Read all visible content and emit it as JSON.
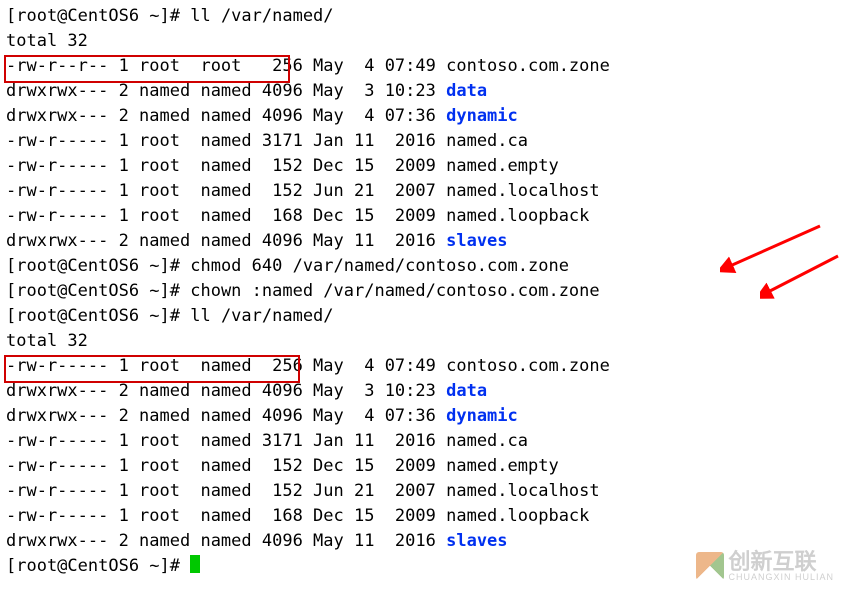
{
  "prompt": "[root@CentOS6 ~]# ",
  "cmd1": "ll /var/named/",
  "total1": "total 32",
  "ls1": [
    {
      "perm": "-rw-r--r--",
      "n": "1",
      "owner": "root ",
      "group": "root ",
      "size": " 256",
      "mo": "May",
      "d": " 4",
      "ty": "07:49",
      "name": "contoso.com.zone",
      "is_dir": false
    },
    {
      "perm": "drwxrwx---",
      "n": "2",
      "owner": "named",
      "group": "named",
      "size": "4096",
      "mo": "May",
      "d": " 3",
      "ty": "10:23",
      "name": "data",
      "is_dir": true
    },
    {
      "perm": "drwxrwx---",
      "n": "2",
      "owner": "named",
      "group": "named",
      "size": "4096",
      "mo": "May",
      "d": " 4",
      "ty": "07:36",
      "name": "dynamic",
      "is_dir": true
    },
    {
      "perm": "-rw-r-----",
      "n": "1",
      "owner": "root ",
      "group": "named",
      "size": "3171",
      "mo": "Jan",
      "d": "11",
      "ty": " 2016",
      "name": "named.ca",
      "is_dir": false
    },
    {
      "perm": "-rw-r-----",
      "n": "1",
      "owner": "root ",
      "group": "named",
      "size": " 152",
      "mo": "Dec",
      "d": "15",
      "ty": " 2009",
      "name": "named.empty",
      "is_dir": false
    },
    {
      "perm": "-rw-r-----",
      "n": "1",
      "owner": "root ",
      "group": "named",
      "size": " 152",
      "mo": "Jun",
      "d": "21",
      "ty": " 2007",
      "name": "named.localhost",
      "is_dir": false
    },
    {
      "perm": "-rw-r-----",
      "n": "1",
      "owner": "root ",
      "group": "named",
      "size": " 168",
      "mo": "Dec",
      "d": "15",
      "ty": " 2009",
      "name": "named.loopback",
      "is_dir": false
    },
    {
      "perm": "drwxrwx---",
      "n": "2",
      "owner": "named",
      "group": "named",
      "size": "4096",
      "mo": "May",
      "d": "11",
      "ty": " 2016",
      "name": "slaves",
      "is_dir": true
    }
  ],
  "cmd2": "chmod 640 /var/named/contoso.com.zone",
  "cmd3": "chown :named /var/named/contoso.com.zone",
  "cmd4": "ll /var/named/",
  "total2": "total 32",
  "ls2": [
    {
      "perm": "-rw-r-----",
      "n": "1",
      "owner": "root ",
      "group": "named",
      "size": " 256",
      "mo": "May",
      "d": " 4",
      "ty": "07:49",
      "name": "contoso.com.zone",
      "is_dir": false
    },
    {
      "perm": "drwxrwx---",
      "n": "2",
      "owner": "named",
      "group": "named",
      "size": "4096",
      "mo": "May",
      "d": " 3",
      "ty": "10:23",
      "name": "data",
      "is_dir": true
    },
    {
      "perm": "drwxrwx---",
      "n": "2",
      "owner": "named",
      "group": "named",
      "size": "4096",
      "mo": "May",
      "d": " 4",
      "ty": "07:36",
      "name": "dynamic",
      "is_dir": true
    },
    {
      "perm": "-rw-r-----",
      "n": "1",
      "owner": "root ",
      "group": "named",
      "size": "3171",
      "mo": "Jan",
      "d": "11",
      "ty": " 2016",
      "name": "named.ca",
      "is_dir": false
    },
    {
      "perm": "-rw-r-----",
      "n": "1",
      "owner": "root ",
      "group": "named",
      "size": " 152",
      "mo": "Dec",
      "d": "15",
      "ty": " 2009",
      "name": "named.empty",
      "is_dir": false
    },
    {
      "perm": "-rw-r-----",
      "n": "1",
      "owner": "root ",
      "group": "named",
      "size": " 152",
      "mo": "Jun",
      "d": "21",
      "ty": " 2007",
      "name": "named.localhost",
      "is_dir": false
    },
    {
      "perm": "-rw-r-----",
      "n": "1",
      "owner": "root ",
      "group": "named",
      "size": " 168",
      "mo": "Dec",
      "d": "15",
      "ty": " 2009",
      "name": "named.loopback",
      "is_dir": false
    },
    {
      "perm": "drwxrwx---",
      "n": "2",
      "owner": "named",
      "group": "named",
      "size": "4096",
      "mo": "May",
      "d": "11",
      "ty": " 2016",
      "name": "slaves",
      "is_dir": true
    }
  ],
  "watermark": {
    "main": "创新互联",
    "sub": "CHUANGXIN HULIAN"
  }
}
